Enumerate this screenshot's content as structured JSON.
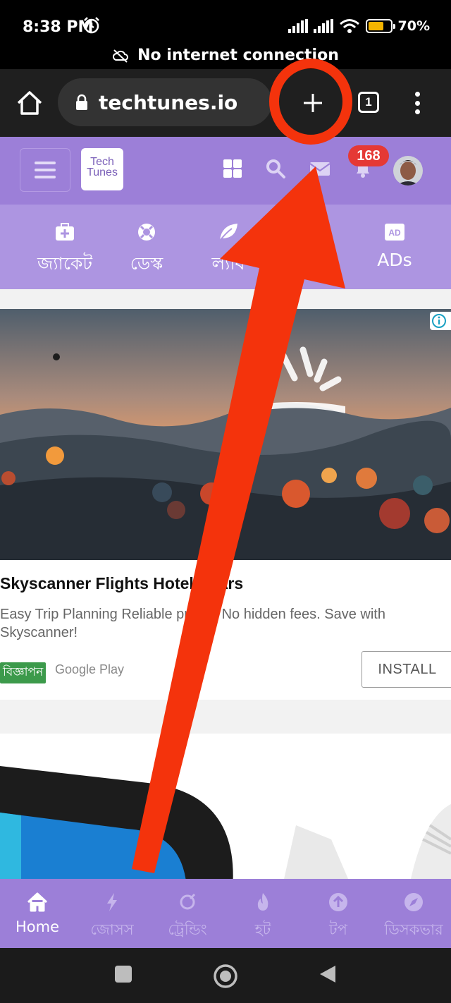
{
  "status_bar": {
    "time": "8:38 PM",
    "battery": "70%",
    "offline_message": "No internet connection"
  },
  "browser": {
    "url": "techtunes.io",
    "tab_count": "1"
  },
  "site_header": {
    "logo_line1": "Tech",
    "logo_line2": "Tunes",
    "notification_count": "168"
  },
  "category_nav": [
    {
      "label": "জ্যাকেট",
      "icon": "first-aid-kit-icon"
    },
    {
      "label": "ডেস্ক",
      "icon": "lifebuoy-icon"
    },
    {
      "label": "ল্যাব",
      "icon": "leaf-icon"
    },
    {
      "label": "",
      "icon": ""
    },
    {
      "label": "ADs",
      "icon": "ad-icon"
    }
  ],
  "ad": {
    "title": "Skyscanner Flights Hotels Cars",
    "description": "Easy Trip Planning Reliable prices. No hidden fees. Save with Skyscanner!",
    "badge": "বিজ্ঞাপন",
    "source": "Google Play",
    "cta": "INSTALL"
  },
  "bottom_nav": [
    {
      "label": "Home",
      "icon": "home-icon",
      "active": true
    },
    {
      "label": "জোসস",
      "icon": "lightning-icon",
      "active": false
    },
    {
      "label": "ট্রেন্ডিং",
      "icon": "trending-icon",
      "active": false
    },
    {
      "label": "হট",
      "icon": "fire-icon",
      "active": false
    },
    {
      "label": "টপ",
      "icon": "arrow-up-icon",
      "active": false
    },
    {
      "label": "ডিসকভার",
      "icon": "compass-icon",
      "active": false
    }
  ],
  "colors": {
    "header_purple": "#9c7fd8",
    "category_purple": "#ad95e1",
    "annotation_red": "#f4330c",
    "badge_green": "#3c9a4b"
  }
}
